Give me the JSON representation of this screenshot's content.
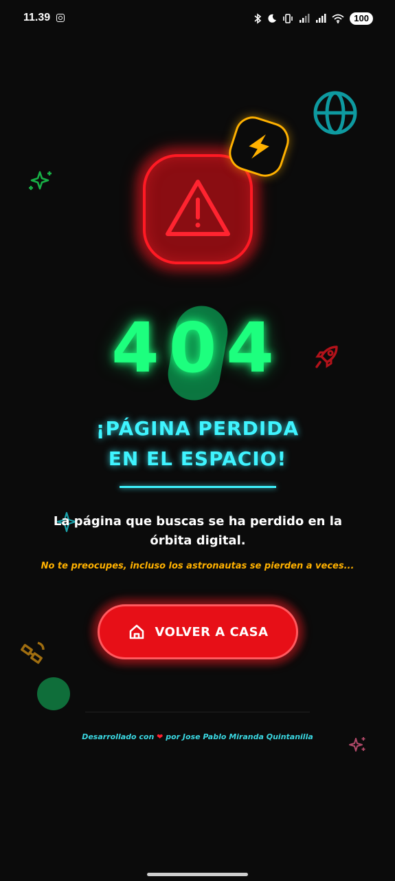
{
  "status_bar": {
    "time": "11.39",
    "battery": "100",
    "icons": [
      "instagram-icon",
      "bluetooth-icon",
      "moon-icon",
      "vibrate-icon",
      "signal-icon",
      "signal-icon",
      "wifi-icon",
      "battery-icon"
    ]
  },
  "main": {
    "code": "404",
    "title_line1": "¡PÁGINA PERDIDA",
    "title_line2": "EN EL ESPACIO!",
    "description": "La página que buscas se ha perdido en la órbita digital.",
    "hint": "No te preocupes, incluso los astronautas se pierden a veces...",
    "button_label": "VOLVER A CASA"
  },
  "footer": {
    "prefix": "Desarrollado con",
    "suffix": "por Jose Pablo Miranda Quintanilla"
  },
  "colors": {
    "background": "#0b0b0b",
    "neon_green": "#1dff7e",
    "neon_cyan": "#3ff4ff",
    "neon_red": "#ff1a24",
    "amber": "#ffb100",
    "button_red": "#e70f17"
  },
  "decor_icons": [
    "globe-icon",
    "lightning-icon",
    "warning-icon",
    "sparkles-icon",
    "rocket-icon",
    "satellite-icon",
    "planet-circle",
    "sparkles-icon",
    "home-icon",
    "heart-icon"
  ]
}
